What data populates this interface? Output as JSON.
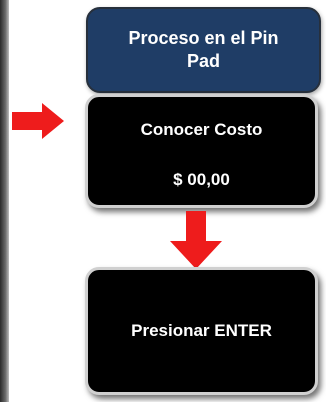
{
  "header": {
    "title": "Proceso en el Pin Pad"
  },
  "steps": [
    {
      "title": "Conocer Costo",
      "amount": "$ 00,00"
    },
    {
      "title": "Presionar ENTER"
    }
  ],
  "icons": {
    "pointer": "arrow-right-icon",
    "flow": "arrow-down-icon"
  },
  "colors": {
    "header_bg": "#1f3d66",
    "step_bg": "#000000",
    "arrow": "#ee1c1c"
  }
}
